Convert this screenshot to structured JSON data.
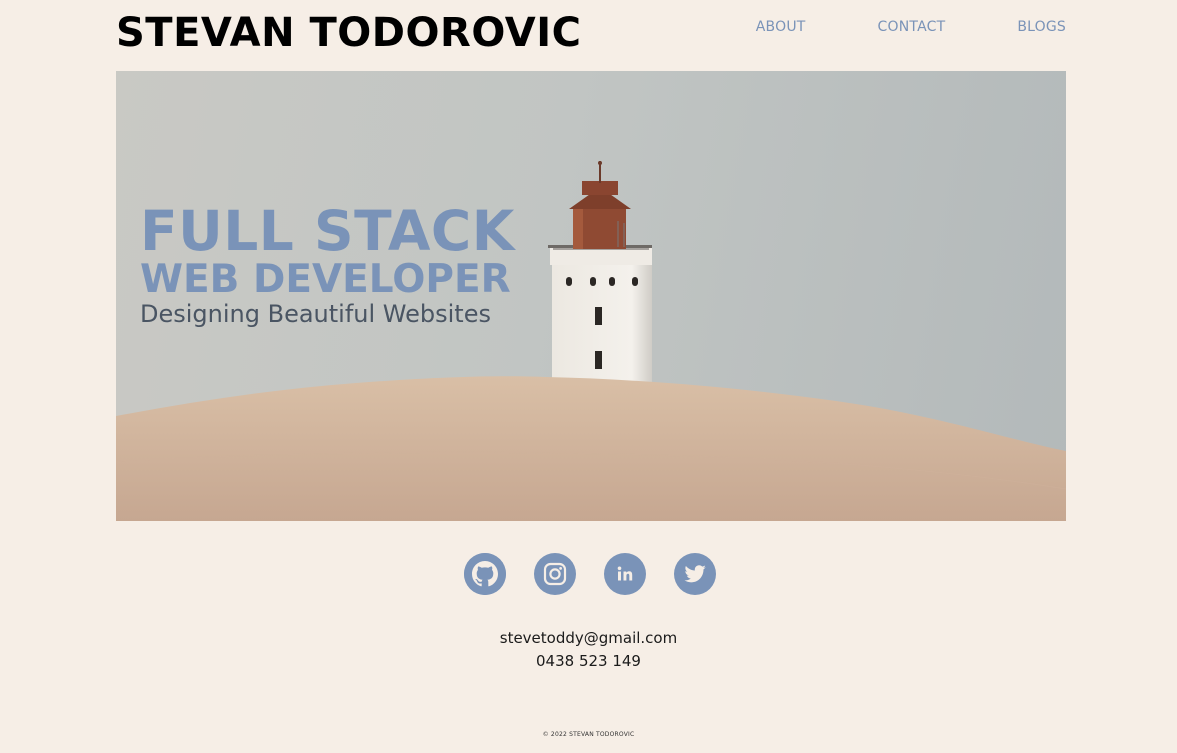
{
  "header": {
    "title": "STEVAN TODOROVIC",
    "nav": {
      "about": "ABOUT",
      "contact": "CONTACT",
      "blogs": "BLOGS"
    }
  },
  "hero": {
    "line1": "FULL STACK",
    "line2": "WEB DEVELOPER",
    "line3": "Designing Beautiful Websites"
  },
  "socials": [
    {
      "icon": "github-icon"
    },
    {
      "icon": "instagram-icon"
    },
    {
      "icon": "linkedin-icon"
    },
    {
      "icon": "twitter-icon"
    }
  ],
  "contact": {
    "email": "stevetoddy@gmail.com",
    "phone": "0438 523 149"
  },
  "footer": {
    "copyright": "© 2022 STEVAN TODOROVIC"
  },
  "colors": {
    "background": "#f6eee6",
    "accent": "#7a93b8",
    "text": "#000000"
  }
}
